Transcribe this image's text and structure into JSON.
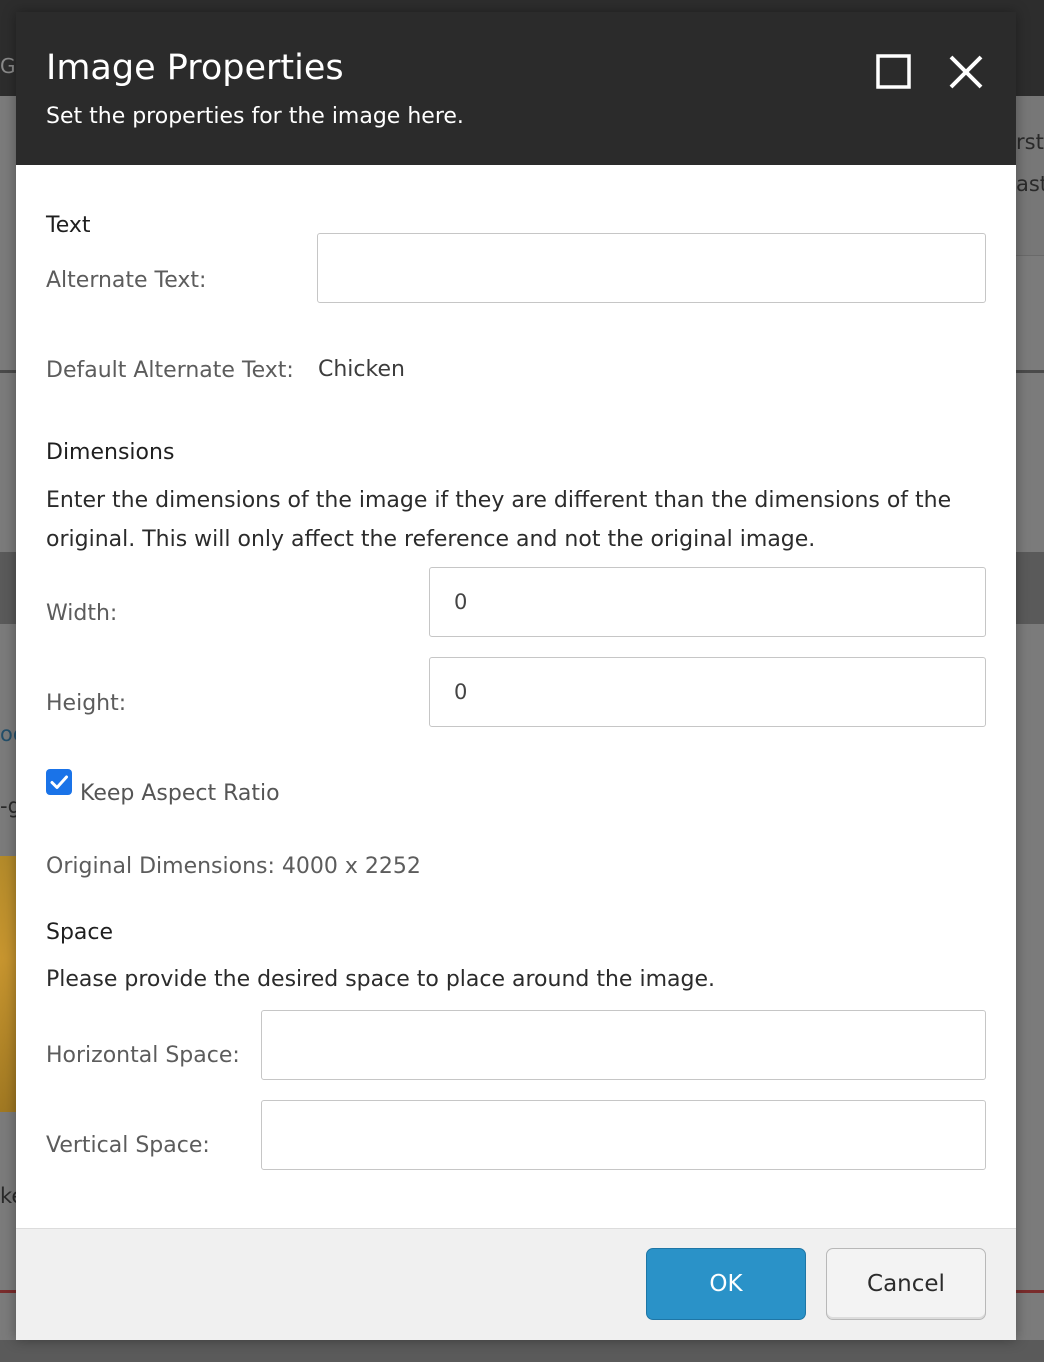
{
  "background": {
    "topbar_text": "GU",
    "right_texts": [
      "rst",
      "ast"
    ],
    "link_text": "oe",
    "side_texts": [
      "-g",
      "ke"
    ]
  },
  "dialog": {
    "title": "Image Properties",
    "subtitle": "Set the properties for the image here.",
    "maximize_icon": "maximize-icon",
    "close_icon": "close-icon"
  },
  "text_section": {
    "heading": "Text",
    "alt_label": "Alternate Text:",
    "alt_value": "",
    "default_alt_label": "Default Alternate Text:",
    "default_alt_value": "Chicken"
  },
  "dimensions": {
    "heading": "Dimensions",
    "description": "Enter the dimensions of the image if they are different than the dimensions of the original. This will only affect the reference and not the original image.",
    "width_label": "Width:",
    "width_value": "0",
    "height_label": "Height:",
    "height_value": "0",
    "keep_aspect_label": "Keep Aspect Ratio",
    "keep_aspect_checked": true,
    "original_label": "Original Dimensions: 4000 x 2252"
  },
  "space": {
    "heading": "Space",
    "description": "Please provide the desired space to place around the image.",
    "horizontal_label": "Horizontal Space:",
    "horizontal_value": "",
    "vertical_label": "Vertical Space:",
    "vertical_value": ""
  },
  "footer": {
    "ok_label": "OK",
    "cancel_label": "Cancel"
  },
  "colors": {
    "header_bg": "#2b2b2b",
    "ok_button": "#2a92c8",
    "checkbox": "#1a73e8"
  }
}
